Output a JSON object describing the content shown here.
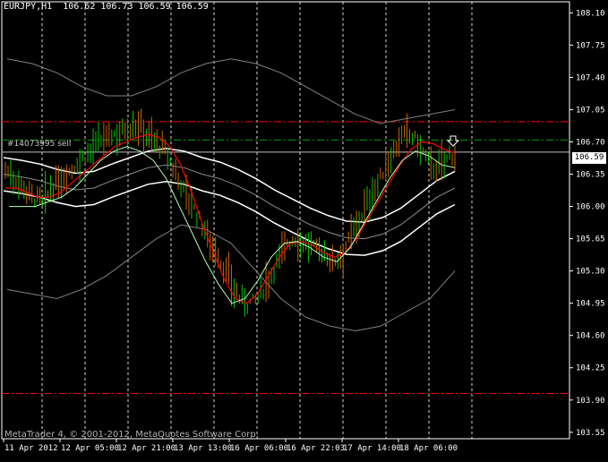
{
  "window": {
    "symbol_line": "EURJPY,H1  106.62 106.73 106.59 106.59",
    "footer": "MetaTrader 4, © 2001-2012, MetaQuotes Software Corp.",
    "order_label": "#14073995 sell",
    "current_price": "106.59"
  },
  "colors": {
    "background": "#000000",
    "axis": "#ffffff",
    "grid": "#ffffff",
    "bull_bar": "#00c800",
    "bear_bar": "#c86400",
    "red_level": "#ff0000",
    "green_level": "#00a000",
    "ma_red": "#ff0000",
    "ma_green": "#b4ffb4",
    "envelope_white": "#ffffff",
    "bollinger_gray": "#808080"
  },
  "chart_data": {
    "type": "ohlc",
    "symbol": "EURJPY",
    "timeframe": "H1",
    "y_ticks": [
      "108.10",
      "107.75",
      "107.40",
      "107.05",
      "106.70",
      "106.35",
      "106.00",
      "105.65",
      "105.30",
      "104.95",
      "104.60",
      "104.25",
      "103.90",
      "103.55"
    ],
    "x_ticks": [
      "11 Apr 2012",
      "12 Apr 05:00",
      "12 Apr 21:00",
      "13 Apr 13:00",
      "16 Apr 06:00",
      "16 Apr 22:03",
      "17 Apr 14:00",
      "18 Apr 06:00"
    ],
    "ylim": [
      103.48,
      108.22
    ],
    "levels": [
      {
        "price": 106.92,
        "style": "dash-dot",
        "color": "red"
      },
      {
        "price": 106.72,
        "style": "dash-dot",
        "color": "green"
      },
      {
        "price": 106.59,
        "style": "solid",
        "color": "gray"
      },
      {
        "price": 103.97,
        "style": "dash-dot",
        "color": "red"
      }
    ],
    "price_series": [
      106.4,
      106.3,
      106.2,
      106.1,
      106.05,
      106.2,
      106.3,
      106.4,
      106.5,
      106.6,
      106.7,
      106.75,
      106.8,
      106.85,
      106.9,
      106.8,
      106.7,
      106.6,
      106.4,
      106.2,
      106.0,
      105.8,
      105.6,
      105.4,
      105.2,
      105.0,
      104.95,
      105.0,
      105.2,
      105.4,
      105.6,
      105.65,
      105.6,
      105.55,
      105.5,
      105.4,
      105.5,
      105.7,
      105.9,
      106.1,
      106.3,
      106.5,
      106.7,
      106.8,
      106.7,
      106.5,
      106.4,
      106.5,
      106.6
    ],
    "ma_red": [
      106.2,
      106.2,
      106.15,
      106.1,
      106.1,
      106.15,
      106.25,
      106.35,
      106.45,
      106.55,
      106.65,
      106.7,
      106.75,
      106.78,
      106.75,
      106.65,
      106.45,
      106.15,
      105.8,
      105.5,
      105.2,
      105.0,
      104.95,
      105.05,
      105.25,
      105.45,
      105.6,
      105.62,
      105.58,
      105.5,
      105.45,
      105.5,
      105.65,
      105.85,
      106.05,
      106.25,
      106.45,
      106.62,
      106.7,
      106.68,
      106.62,
      106.58
    ],
    "ma_green": [
      106.0,
      106.0,
      106.0,
      106.05,
      106.1,
      106.2,
      106.35,
      106.5,
      106.6,
      106.65,
      106.6,
      106.5,
      106.3,
      106.0,
      105.7,
      105.4,
      105.15,
      104.95,
      105.0,
      105.2,
      105.45,
      105.6,
      105.62,
      105.55,
      105.45,
      105.4,
      105.55,
      105.8,
      106.05,
      106.3,
      106.5,
      106.6,
      106.55,
      106.45,
      106.42
    ],
    "envelope": [
      106.35,
      106.32,
      106.28,
      106.22,
      106.18,
      106.2,
      106.28,
      106.35,
      106.42,
      106.45,
      106.42,
      106.35,
      106.3,
      106.22,
      106.12,
      106.0,
      105.9,
      105.8,
      105.72,
      105.66,
      105.65,
      105.7,
      105.8,
      105.95,
      106.1,
      106.2
    ],
    "bollinger_upper": [
      107.6,
      107.55,
      107.45,
      107.3,
      107.2,
      107.2,
      107.3,
      107.45,
      107.55,
      107.6,
      107.55,
      107.45,
      107.3,
      107.15,
      107.0,
      106.9,
      106.95,
      107.0,
      107.05
    ],
    "bollinger_lower": [
      105.1,
      105.05,
      105.0,
      105.1,
      105.25,
      105.45,
      105.65,
      105.8,
      105.75,
      105.6,
      105.3,
      105.0,
      104.8,
      104.7,
      104.65,
      104.7,
      104.85,
      105.0,
      105.3
    ]
  }
}
